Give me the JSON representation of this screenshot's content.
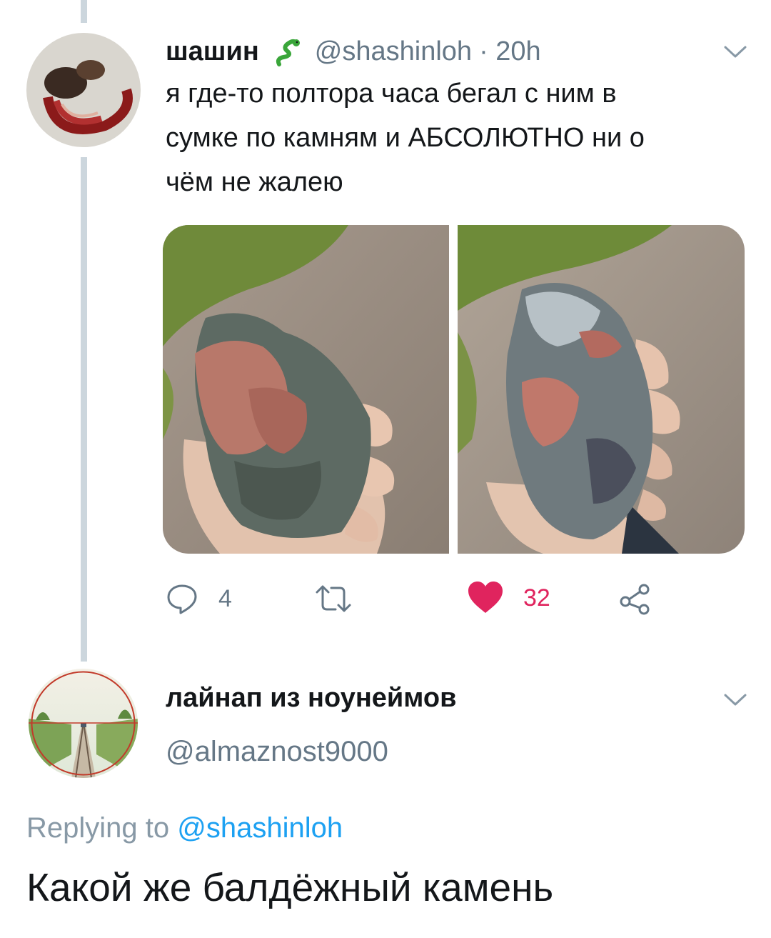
{
  "tweet": {
    "display_name": "шашин",
    "handle": "@shashinloh",
    "time": "· 20h",
    "text_lines": [
      "я где-то полтора часа бегал с ним в",
      "сумке по камням и АБСОЛЮТНО ни о",
      "чём не жалею"
    ],
    "replies_count": "4",
    "retweets_count": "",
    "likes_count": "32",
    "icons": {
      "name_badge": "snake-emoji-icon",
      "menu": "chevron-down-icon",
      "reply": "reply-icon",
      "retweet": "retweet-icon",
      "like": "heart-icon",
      "share": "share-icon"
    }
  },
  "reply": {
    "display_name": "лайнап из ноунеймов",
    "handle": "@almaznost9000",
    "replying_prefix": "Replying to",
    "replying_to": "@shashinloh",
    "text": "Какой же балдёжный камень"
  },
  "colors": {
    "text": "#14171a",
    "muted": "#657786",
    "link": "#1da1f2",
    "like": "#e0245e",
    "thread_line": "#ccd6dd"
  }
}
